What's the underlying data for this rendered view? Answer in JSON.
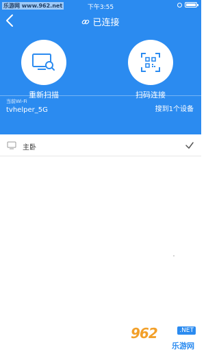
{
  "status_bar": {
    "watermark": "乐游网 www.962.net",
    "time": "下午3:55"
  },
  "nav": {
    "title": "已连接"
  },
  "actions": [
    {
      "label": "重新扫描",
      "icon": "tv-search-icon"
    },
    {
      "label": "扫码连接",
      "icon": "qr-scan-icon"
    }
  ],
  "wifi": {
    "caption": "当前Wi-Fi",
    "name": "tvhelper_5G",
    "device_count_text": "搜到1个设备"
  },
  "devices": [
    {
      "name": "主卧",
      "selected": true,
      "icon": "tv-icon"
    }
  ],
  "watermark_bottom": {
    "logo": "962",
    "badge": ".NET",
    "sub": "乐游网"
  },
  "colors": {
    "primary": "#2b8bf0",
    "background": "#ffffff",
    "text": "#333333"
  }
}
